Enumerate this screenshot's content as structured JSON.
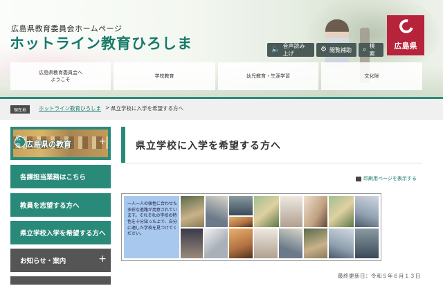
{
  "header": {
    "subtitle": "広島県教育委員会ホームページ",
    "title": "ホットライン教育ひろしま",
    "logo_text": "広島県",
    "utilities": [
      {
        "label": "音声読み上げ",
        "icon": "speaker-icon"
      },
      {
        "label": "閲覧補助",
        "icon": "gear-icon"
      },
      {
        "label": "検索",
        "icon": "search-icon"
      }
    ],
    "nav": [
      {
        "line1": "広島県教育委員会へ",
        "line2": "ようこそ"
      },
      {
        "line1": "学校教育",
        "line2": ""
      },
      {
        "line1": "幼児教育・生涯学習",
        "line2": ""
      },
      {
        "line1": "文化財",
        "line2": ""
      }
    ],
    "accent_color": "#2a8a7a",
    "logo_color": "#b7233a"
  },
  "breadcrumb": {
    "tag": "現在地",
    "home_link": "ホットライン教育ひろしま",
    "separator": ">",
    "current": "県立学校に入学を希望する方へ"
  },
  "sidebar": {
    "banner_text": "広島県の教育",
    "banner_icon_text": "広島",
    "items": [
      {
        "label": "各課担当業務はこちら"
      },
      {
        "label": "教員を志望する方へ"
      },
      {
        "label": "県立学校入学を希望する方へ"
      },
      {
        "label": "お知らせ・案内",
        "toggle": "+"
      }
    ]
  },
  "main": {
    "title": "県立学校に入学を希望する方へ",
    "print_label": "印刷用ページを表示する",
    "banner_text": "一人一人の個性に合わせた多彩な進路が用意されています。それぞれの学校の特色を十分知った上で、自分に適した学校を見つけてください。",
    "last_updated": "最終更新日：令和５年６月１３日"
  }
}
